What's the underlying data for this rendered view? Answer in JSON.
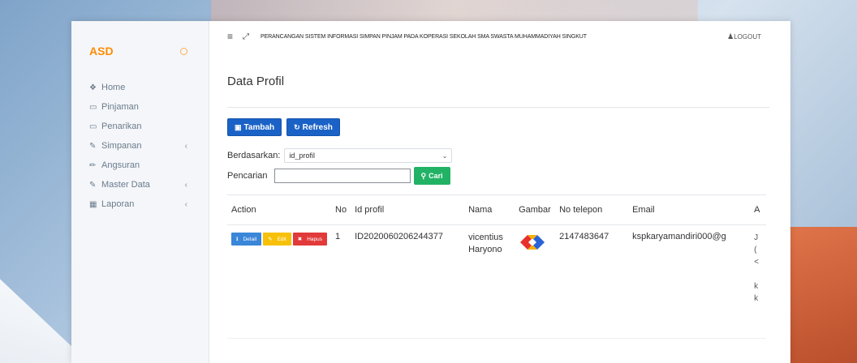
{
  "sidebar": {
    "brand": "ASD",
    "items": [
      {
        "icon": "home-icon",
        "glyph": "❖",
        "label": "Home",
        "chevron": ""
      },
      {
        "icon": "credit-card-icon",
        "glyph": "▭",
        "label": "Pinjaman",
        "chevron": ""
      },
      {
        "icon": "credit-card-icon",
        "glyph": "▭",
        "label": "Penarikan",
        "chevron": ""
      },
      {
        "icon": "edit-icon",
        "glyph": "✎",
        "label": "Simpanan",
        "chevron": "‹"
      },
      {
        "icon": "pencil-icon",
        "glyph": "✏",
        "label": "Angsuran",
        "chevron": ""
      },
      {
        "icon": "edit-icon",
        "glyph": "✎",
        "label": "Master Data",
        "chevron": "‹"
      },
      {
        "icon": "calendar-icon",
        "glyph": "▦",
        "label": "Laporan",
        "chevron": "‹"
      }
    ]
  },
  "topbar": {
    "title": "PERANCANGAN SISTEM INFORMASI SIMPAN PINJAM PADA KOPERASI SEKOLAH SMA SWASTA MUHAMMADIYAH SINGKUT",
    "logout": "LOGOUT"
  },
  "page": {
    "title": "Data Profil",
    "tambah": "Tambah",
    "refresh": "Refresh",
    "filter_label": "Berdasarkan:",
    "filter_value": "id_profil",
    "search_label": "Pencarian",
    "search_value": "",
    "cari": "Cari"
  },
  "table": {
    "headers": [
      "Action",
      "No",
      "Id profil",
      "Nama",
      "Gambar",
      "No telepon",
      "Email",
      "A"
    ],
    "row": {
      "detail": "Detail",
      "edit": "Edit",
      "hapus": "Hapus",
      "no": "1",
      "id_profil": "ID2020060206244377",
      "nama": "vicentius Haryono",
      "no_telepon": "2147483647",
      "email": "kspkaryamandiri000@g",
      "a_fragments": [
        "J",
        "(",
        "<",
        "",
        "k",
        "k"
      ]
    }
  },
  "colors": {
    "brand": "#ff8c00",
    "primary": "#1a62c6",
    "success": "#22b265",
    "info": "#3a86d8",
    "warning": "#f7c10a",
    "danger": "#e23a3a"
  }
}
